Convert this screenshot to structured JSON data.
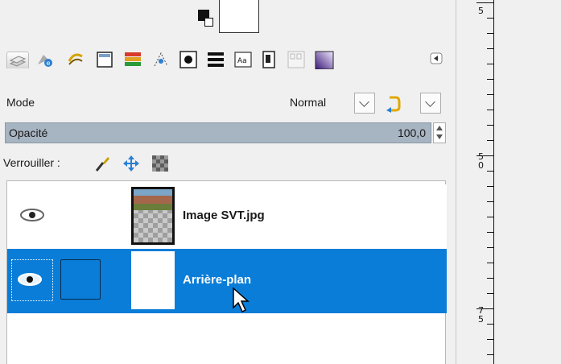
{
  "palette": {
    "fg_color": "#111111",
    "bg_color": "#ffffff"
  },
  "tabs": [
    {
      "icon": "layers-icon"
    },
    {
      "icon": "channels-icon"
    },
    {
      "icon": "paths-icon"
    },
    {
      "icon": "colormap-icon"
    },
    {
      "icon": "histogram-icon"
    },
    {
      "icon": "selection-editor-icon"
    },
    {
      "icon": "navigation-icon"
    },
    {
      "icon": "undo-history-icon"
    },
    {
      "icon": "fonts-icon"
    },
    {
      "icon": "document-history-icon"
    },
    {
      "icon": "templates-icon"
    },
    {
      "icon": "gradients-icon"
    }
  ],
  "mode": {
    "label": "Mode",
    "value": "Normal"
  },
  "opacity": {
    "label": "Opacité",
    "value": "100,0"
  },
  "lock": {
    "label": "Verrouiller :"
  },
  "layers": [
    {
      "name": "Image SVT.jpg",
      "visible": true,
      "selected": false
    },
    {
      "name": "Arrière-plan",
      "visible": true,
      "selected": true
    }
  ],
  "ruler": {
    "labels": [
      "5",
      "50",
      "75"
    ]
  },
  "colors": {
    "selection": "#0a7dd8",
    "opacity_bar": "#a7b4c1"
  }
}
